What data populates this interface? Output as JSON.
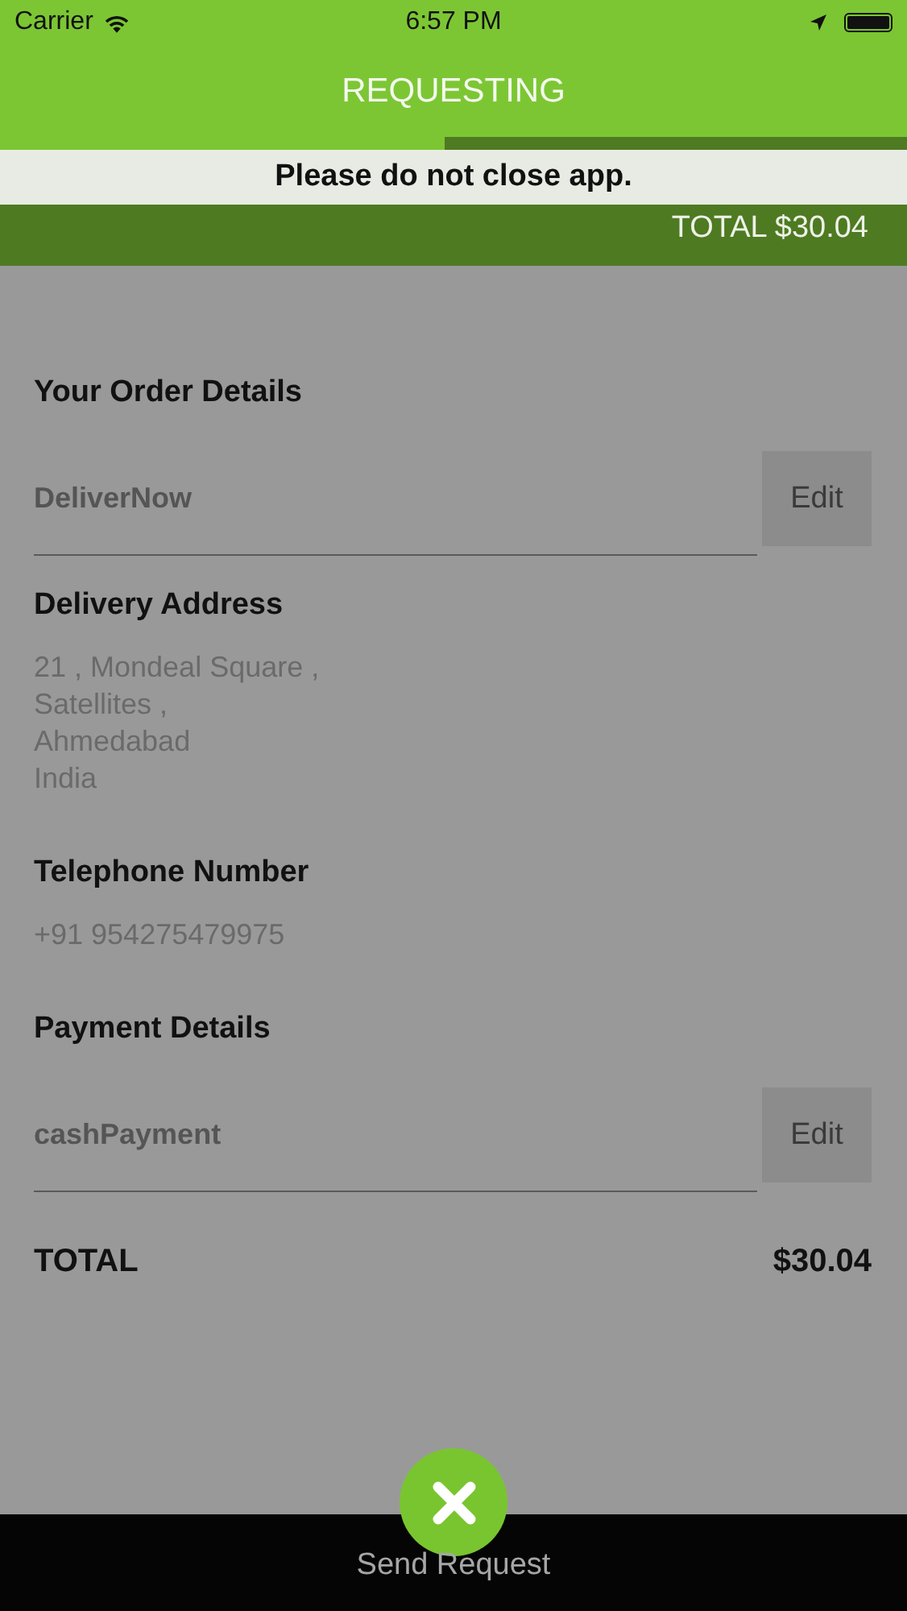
{
  "status_bar": {
    "carrier": "Carrier",
    "time": "6:57 PM"
  },
  "nav": {
    "title": "REQUESTING",
    "progress": {
      "level": 0.49
    },
    "notice": "Please do not close app.",
    "header_total": "TOTAL  $30.04"
  },
  "sections": [
    {
      "kind": "editable",
      "heading": "Your Order Details",
      "value": "DeliverNow",
      "button": "Edit"
    },
    {
      "kind": "lines",
      "heading": "Delivery Address",
      "lines": [
        "21 , Mondeal Square ,",
        "Satellites ,",
        "Ahmedabad",
        "India"
      ]
    },
    {
      "kind": "lines",
      "heading": "Telephone Number",
      "lines": [
        "+91 954275479975"
      ]
    },
    {
      "kind": "editable",
      "heading": "Payment Details",
      "value": "cashPayment",
      "button": "Edit"
    }
  ],
  "total": {
    "label": "TOTAL",
    "amount": "$30.04"
  },
  "bottom_bar": {
    "label": "Send Request"
  }
}
